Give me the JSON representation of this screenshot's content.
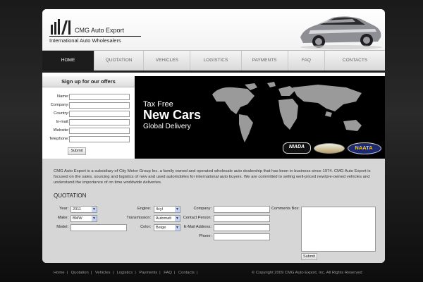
{
  "header": {
    "logo_title": "CMG Auto Export",
    "logo_subtitle": "International Auto Wholesalers"
  },
  "nav": [
    "HOME",
    "QUOTATION",
    "VEHICLES",
    "LOGISTICS",
    "PAYMENTS",
    "FAQ",
    "CONTACTS"
  ],
  "signup": {
    "title": "Sign up for our offers",
    "fields": [
      "Name:",
      "Company:",
      "Country:",
      "E-mail:",
      "Website:",
      "Telephone:"
    ],
    "submit": "Submit"
  },
  "banner": {
    "line1": "Tax Free",
    "line2": "New Cars",
    "line3": "Global Delivery",
    "badges": [
      "NIADA",
      "NAATA"
    ]
  },
  "intro": "CMG Auto Export is a subsidiary of City Motor Group Inc. a family owned and operated wholesale auto dealership that has been in business since 1974. CMG Auto Export is focused on the sales, sourcing and logistics of new and used automobiles for international auto buyers. We are committed to selling well-priced new/pre-owned vehicles and understand the importance of on time worldwide deliveries.",
  "quotation": {
    "title": "QUOTATION",
    "year_label": "Year:",
    "year_value": "2011",
    "make_label": "Make:",
    "make_value": "BMW",
    "model_label": "Model:",
    "engine_label": "Engine:",
    "engine_value": "4cyl",
    "transmission_label": "Transmission:",
    "transmission_value": "Automati",
    "color_label": "Color:",
    "color_value": "Beige",
    "company_label": "Company:",
    "contact_label": "Contact Person:",
    "email_label": "E-Mail Address:",
    "phone_label": "Phone:",
    "comments_label": "Comments Box:",
    "submit": "Submit"
  },
  "footer": {
    "links": [
      "Home",
      "Quotation",
      "Vehicles",
      "Logistics",
      "Payments",
      "FAQ",
      "Contacts"
    ],
    "separator": "|",
    "copyright": "© Copyright 2009 CMG Auto Export, Inc. All Rights Reserved"
  }
}
